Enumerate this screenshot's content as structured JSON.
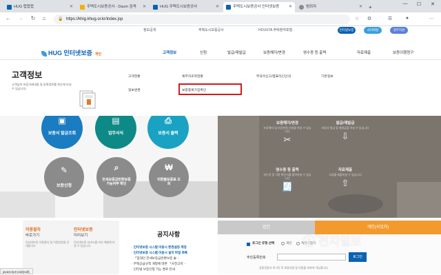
{
  "browser": {
    "tabs": [
      {
        "title": "HUG 럽럽럽",
        "active": false,
        "color": "#0c62b0"
      },
      {
        "title": "주택도시보증공사 - Daum 검색",
        "active": false,
        "color": "#f2b10a"
      },
      {
        "title": "HUG 주택도시보증공사",
        "active": false,
        "color": "#0c62b0"
      },
      {
        "title": "주택도시보증공사 인터넷보증",
        "active": true,
        "color": "#0c62b0"
      },
      {
        "title": "범죄자",
        "active": false,
        "color": "#8a8a8a"
      }
    ],
    "url": "https://khig.khug.or.kr/index.jsp",
    "status_url": "javascript:void(null);"
  },
  "site": {
    "top_links": [
      "정보공개",
      "주택도시보증공사",
      "HOUSTA 주택청약포털"
    ],
    "top_buttons": [
      {
        "label": "인터넷보증",
        "color": "#0c62b0"
      },
      {
        "label": "사이버창",
        "color": "#39a0dc"
      },
      {
        "label": "정부지원",
        "color": "#5a7fd8"
      }
    ],
    "logo": {
      "text": "HUG 인터넷보증",
      "sub": "개인"
    },
    "gnb": [
      "고객정보",
      "신청",
      "발급/재발급",
      "보증해지/변경",
      "영수증 등 출력",
      "자료제출",
      "보증이행청구"
    ],
    "gnb_active": "고객정보",
    "section": {
      "title": "고객정보",
      "desc": "고객님의 보증거래내용 및 등록정보를 한눈에 보실 수 있습니다."
    },
    "submenu": [
      {
        "label": "고객현황"
      },
      {
        "label": "채무자조회현황"
      },
      {
        "label": "부과리신고/별표타인인대"
      },
      {
        "label": "기본정보"
      },
      {
        "label": "정보변경"
      },
      {
        "label": "보증중복가입확인"
      }
    ],
    "quick_circles": [
      {
        "label": "보증서 발급조회",
        "icon": "certificate-icon",
        "color": "#1a7cc1"
      },
      {
        "label": "업무서식",
        "icon": "document-icon",
        "color": "#0d8a86"
      },
      {
        "label": "보증서 출력",
        "icon": "printer-icon",
        "color": "#19a2c2"
      },
      {
        "label": "보증신청",
        "icon": "form-icon",
        "color": "#8b8b8b"
      },
      {
        "label": "전세보증금반환보증 가능여부 확인",
        "icon": "search-doc-icon",
        "color": "#8b8b8b"
      },
      {
        "label": "미환불보증료 조회",
        "icon": "won-icon",
        "color": "#8b8b8b"
      }
    ],
    "services": [
      {
        "title": "보증해지/변경",
        "desc": "보증해지 및 보증변경 신청을 하실 수 있습니다",
        "icon": "scissors-icon"
      },
      {
        "title": "발급/재발급",
        "desc": "보증서 발급 및 재발급을 하실 수 있습니다",
        "icon": "inbox-icon"
      },
      {
        "title": "영수증 등 출력",
        "desc": "영수증 및 각종 확인서를 출력하실 수 있습니다",
        "icon": "receipt-icon"
      },
      {
        "title": "자료제출",
        "desc": "서류를 제출하실 수 있습니다",
        "icon": "upload-icon"
      }
    ],
    "bottom_left": [
      {
        "title": "이용절차",
        "sub": "바로가기",
        "desc": "인터넷보증 이용절차 및 이용방법을 안내합니다"
      },
      {
        "title": "인터넷보증",
        "sub": "미리보기",
        "desc": "인터넷보증 서비스를 미리 체험해 보실 수 있습니다"
      }
    ],
    "notice": {
      "title": "공지사항",
      "items": [
        {
          "prefix": "· 인터넷보증 시스템 이용시 환경설정 계정",
          "bold": true
        },
        {
          "prefix": "· 인터넷보증 시스템 이용시 설치 파일 목록",
          "bold": true
        },
        {
          "prefix": "· 「임대인 전세보증금반환보증 술···",
          "bold": false
        },
        {
          "prefix": "· 주택공급규칙 개정에 따른 「사전고지···",
          "bold": false
        },
        {
          "prefix": "· 인터넷 보증신청 가능 경로 안내",
          "bold": false
        }
      ]
    },
    "login": {
      "tab_person": "법인",
      "tab_biz": "개인(사업자)",
      "remember_label": "로그인 유형 선택",
      "option1": "개인",
      "option2": "개인사업자",
      "id_label": "주민등록번호",
      "login_button": "로그인",
      "help_text": "공동인증서 로그인 후 보증신청 및 인증을 하셔야 가능합니다"
    },
    "watermark": "천지일보"
  }
}
